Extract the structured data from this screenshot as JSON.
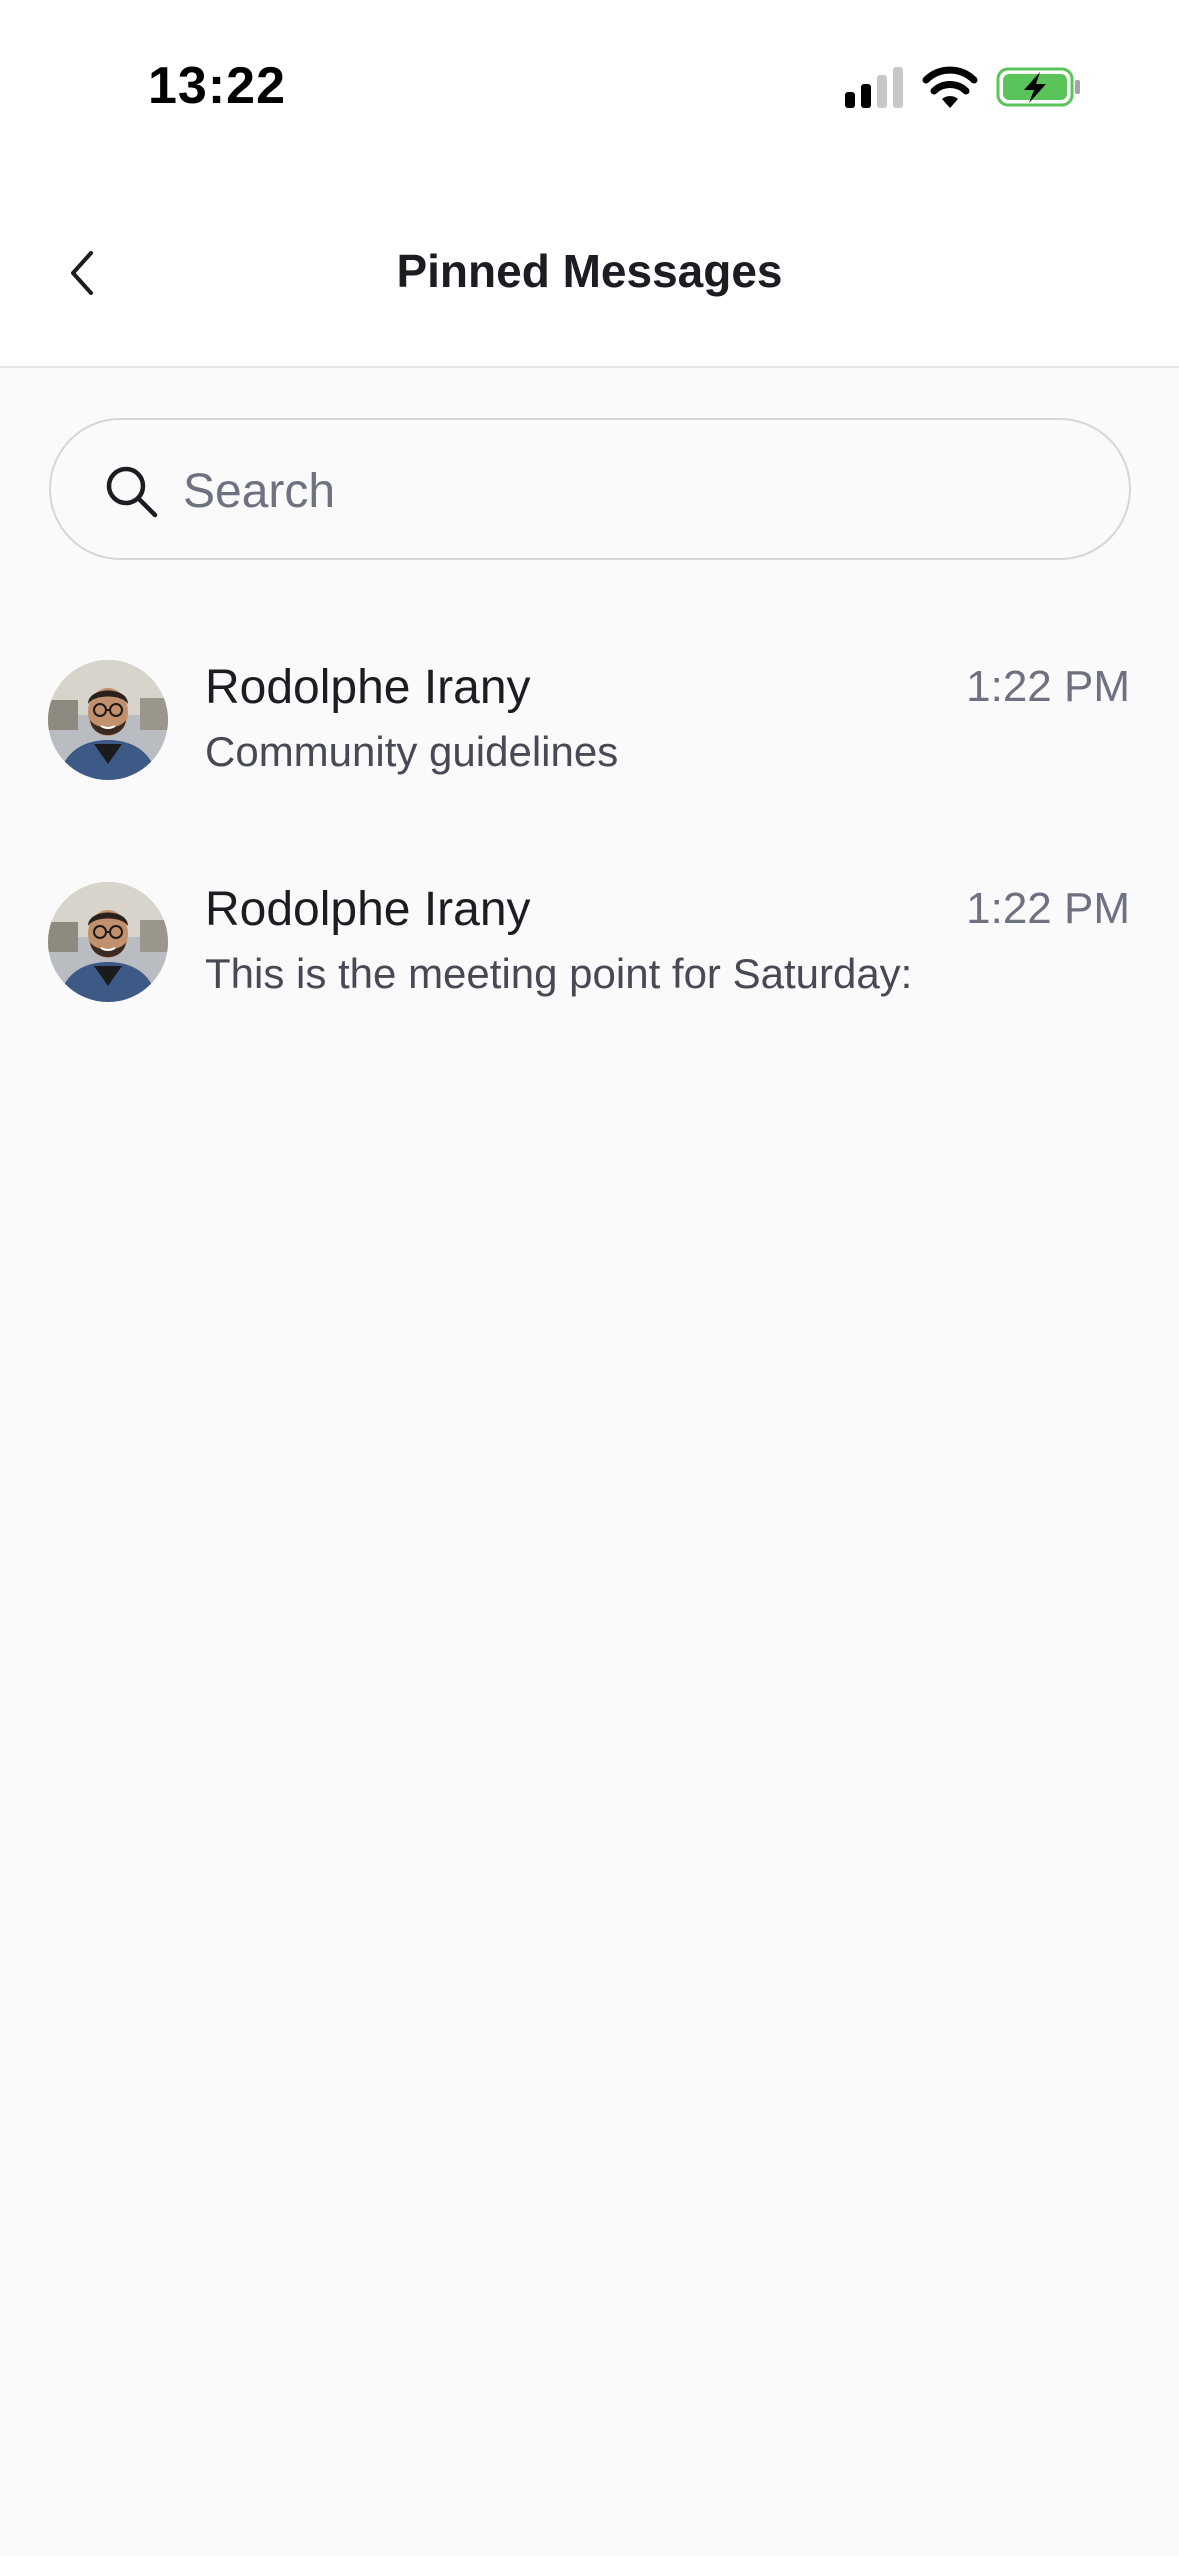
{
  "status_bar": {
    "time": "13:22",
    "signal_icon": "cellular-signal-icon",
    "wifi_icon": "wifi-icon",
    "battery_icon": "battery-charging-icon",
    "battery_color": "#5ac45a"
  },
  "nav": {
    "title": "Pinned Messages",
    "back_icon": "chevron-left-icon"
  },
  "search": {
    "placeholder": "Search",
    "value": "",
    "icon": "search-icon"
  },
  "messages": [
    {
      "author": "Rodolphe Irany",
      "time": "1:22 PM",
      "preview": "Community guidelines",
      "avatar_icon": "avatar"
    },
    {
      "author": "Rodolphe Irany",
      "time": "1:22 PM",
      "preview": "This is the meeting point for Saturday:",
      "avatar_icon": "avatar"
    }
  ],
  "colors": {
    "background": "#fafafa",
    "header_background": "#ffffff",
    "primary_text": "#1c1d22",
    "secondary_text": "#6e7180",
    "border": "#d4d6db"
  }
}
